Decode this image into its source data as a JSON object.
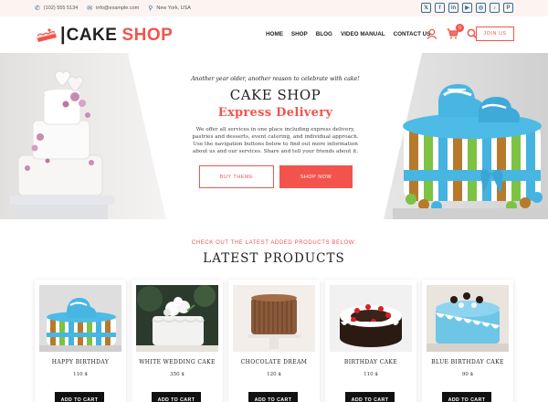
{
  "topbar": {
    "phone": "(102) 555 5134",
    "email": "info@example.com",
    "location": "New York, USA",
    "social": [
      {
        "icon": "x-icon",
        "glyph": "𝕏"
      },
      {
        "icon": "facebook-icon",
        "glyph": "f"
      },
      {
        "icon": "linkedin-icon",
        "glyph": "in"
      },
      {
        "icon": "youtube-icon",
        "glyph": "▶"
      },
      {
        "icon": "instagram-icon",
        "glyph": "◎"
      },
      {
        "icon": "tiktok-icon",
        "glyph": "♪"
      },
      {
        "icon": "pinterest-icon",
        "glyph": "P"
      }
    ]
  },
  "header": {
    "logo_part1": "CAKE",
    "logo_part2": "SHOP",
    "nav": [
      "HOME",
      "SHOP",
      "BLOG",
      "VIDEO MANUAL",
      "CONTACT US"
    ],
    "cart_count": "0",
    "join_label": "JOIN US"
  },
  "hero": {
    "tagline": "Another year older, another reason to celebrate with cake!",
    "title": "CAKE SHOP",
    "subtitle": "Express Delivery",
    "description": "We offer all services in one place including express delivery, pastries and desserts, event catering, and individual approach. Use the navigation buttons below to find out more information about us and our services. Share and tell your friends about it.",
    "btn_buy": "BUY THEME",
    "btn_shop": "SHOP NOW"
  },
  "products": {
    "kicker": "CHECK OUT THE LATEST ADDED PRODUCTS BELOW:",
    "title": "LATEST PRODUCTS",
    "add_to_cart": "ADD TO CART",
    "items": [
      {
        "name": "HAPPY BIRTHDAY",
        "price": "110 $"
      },
      {
        "name": "WHITE WEDDING CAKE",
        "price": "350 $"
      },
      {
        "name": "CHOCOLATE DREAM",
        "price": "120 $"
      },
      {
        "name": "BIRTHDAY CAKE",
        "price": "110 $"
      },
      {
        "name": "BLUE BIRTHDAY CAKE",
        "price": "90 $"
      }
    ]
  },
  "colors": {
    "accent": "#f2544d",
    "icon_blue": "#2f6f93",
    "dark": "#111111"
  }
}
